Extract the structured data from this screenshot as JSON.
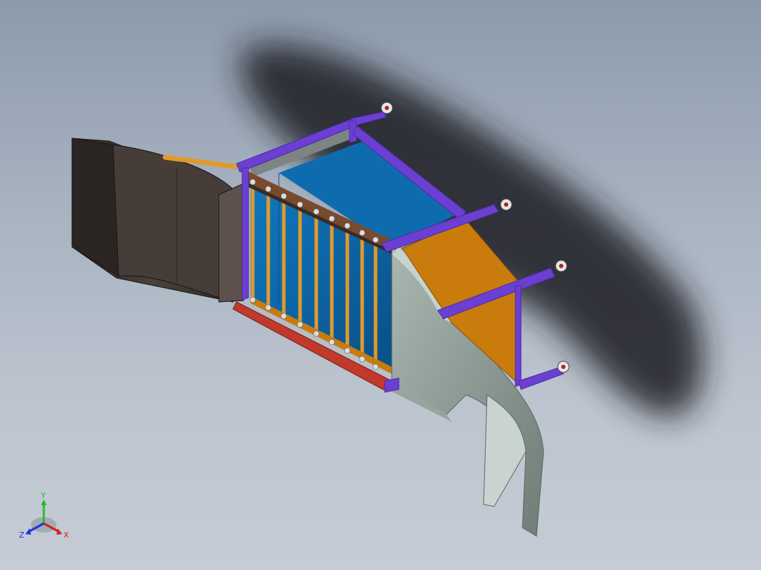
{
  "viewport": {
    "background_top": "#8c9aac",
    "background_bottom": "#c6ccd5"
  },
  "model": {
    "colors": {
      "hood_dark": "#3a3230",
      "hood_mid": "#4a403c",
      "hood_light": "#5c514c",
      "frame_purple": "#6b3fd1",
      "frame_purple_dark": "#4e2aa3",
      "panel_blue": "#0e6cae",
      "panel_blue_dark": "#0a4f86",
      "panel_orange": "#c97b0c",
      "panel_gray": "#7e8c84",
      "panel_gray_light": "#b9c6c2",
      "base_red": "#c0392b",
      "rod_orange": "#e09a2c",
      "shadow": "#1c1f24"
    }
  },
  "triad": {
    "x_label": "X",
    "y_label": "Y",
    "z_label": "Z",
    "x_color": "#d42020",
    "y_color": "#1fbf2a",
    "z_color": "#1c32d8"
  }
}
